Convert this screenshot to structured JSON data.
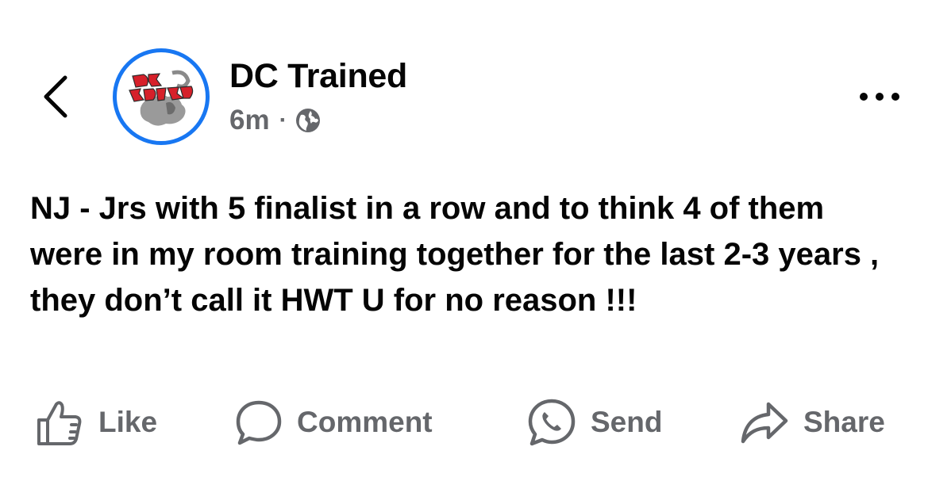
{
  "header": {
    "back_icon": "chevron-left-icon",
    "page_name": "DC Trained",
    "time_ago": "6m",
    "separator": "·",
    "audience_icon": "globe-icon",
    "more_icon": "more-horizontal-icon",
    "avatar": {
      "logo_text": "DC Trained",
      "ring_color": "#1877f2",
      "logo_color": "#d6202a"
    }
  },
  "post": {
    "text": "NJ - Jrs with 5 finalist in a row and to think 4 of them were in my room training together for the last 2-3 years , they don’t call it HWT U for no reason !!!"
  },
  "actions": [
    {
      "label": "Like",
      "icon": "thumbs-up-icon"
    },
    {
      "label": "Comment",
      "icon": "comment-bubble-icon"
    },
    {
      "label": "Send",
      "icon": "messenger-send-icon"
    },
    {
      "label": "Share",
      "icon": "share-arrow-icon"
    }
  ],
  "colors": {
    "text": "#050505",
    "secondary_text": "#65676b",
    "accent": "#1877f2"
  }
}
